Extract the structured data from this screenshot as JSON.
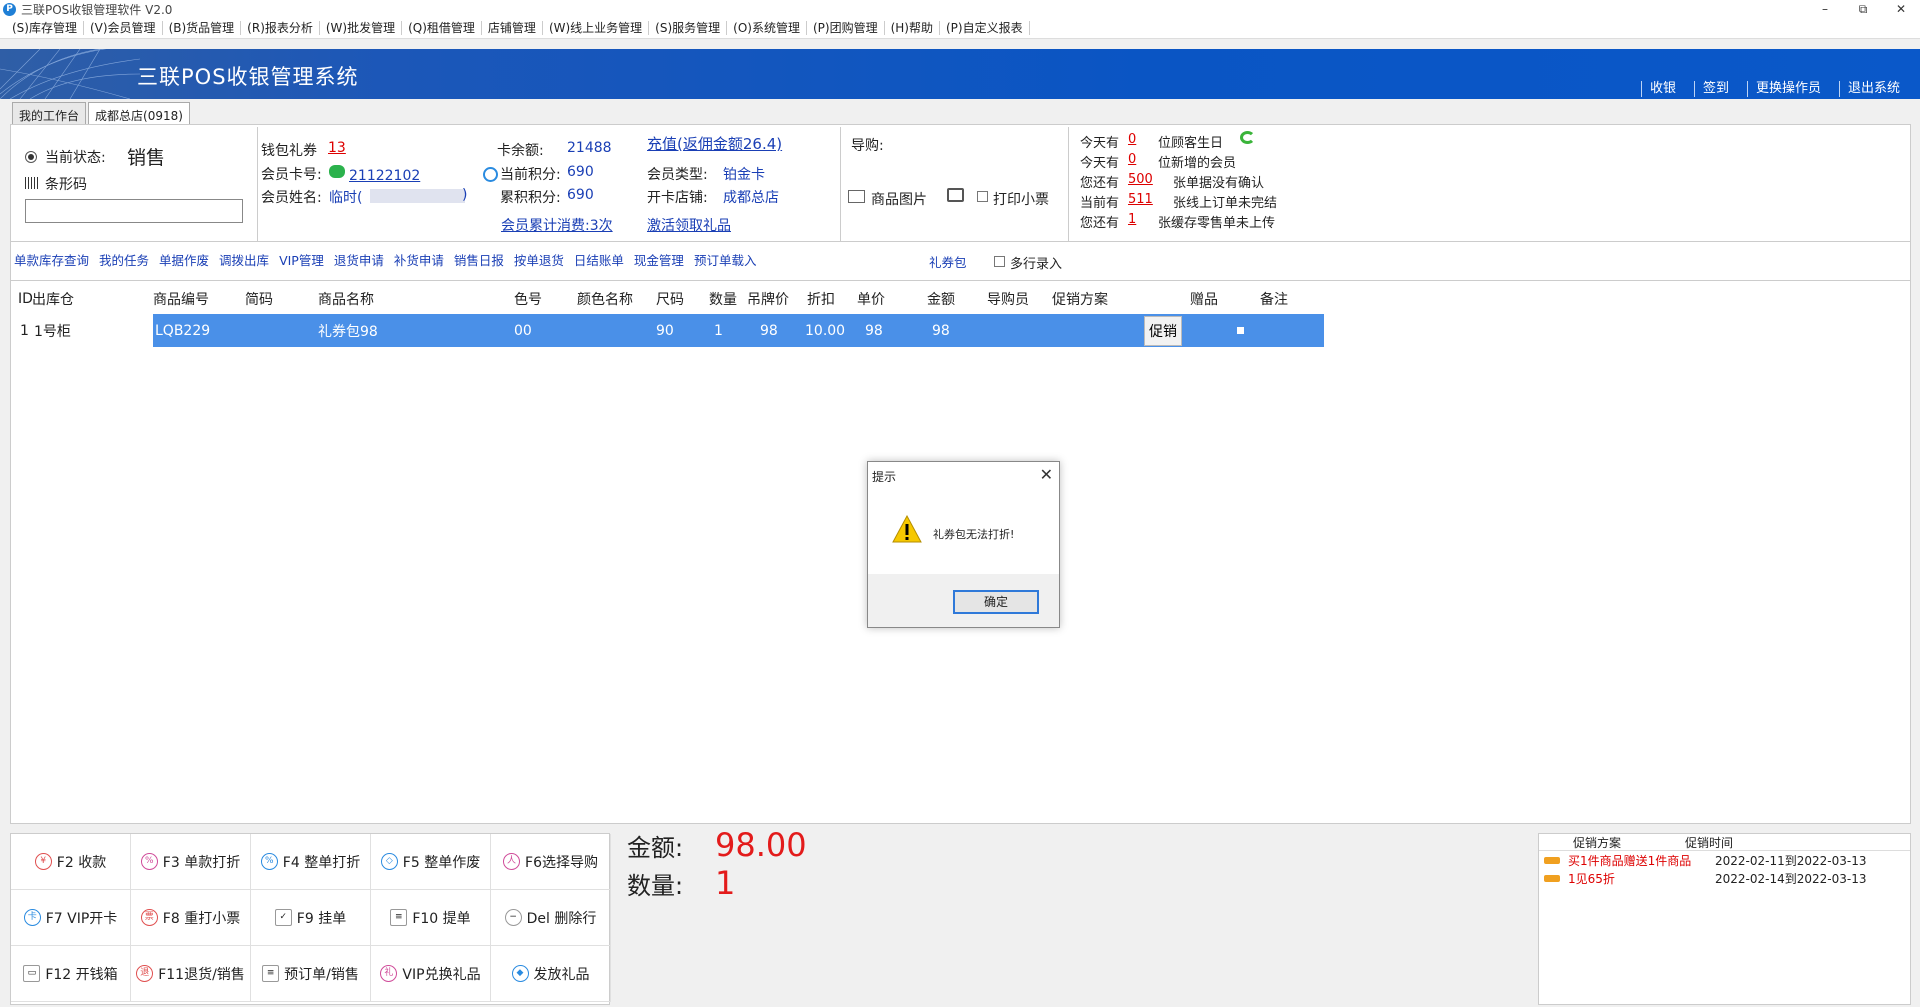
{
  "window": {
    "title": "三联POS收银管理软件 V2.0",
    "controls": [
      "–",
      "⧉",
      "✕"
    ]
  },
  "menu": [
    "(S)库存管理",
    "(V)会员管理",
    "(B)货品管理",
    "(R)报表分析",
    "(W)批发管理",
    "(Q)租借管理",
    "店铺管理",
    "(W)线上业务管理",
    "(S)服务管理",
    "(O)系统管理",
    "(P)团购管理",
    "(H)帮助",
    "(P)自定义报表"
  ],
  "banner": {
    "title": "三联POS收银管理系统",
    "nav": [
      "收银",
      "签到",
      "更换操作员",
      "退出系统"
    ]
  },
  "tabs": [
    "我的工作台",
    "成都总店(0918)"
  ],
  "status": {
    "state_label": "当前状态:",
    "state_value": "销售",
    "barcode_label": "条形码",
    "barcode_value": ""
  },
  "member": {
    "wallet_label": "钱包礼券",
    "wallet_value": "13",
    "card_label": "会员卡号:",
    "card_value": "21122102",
    "name_label": "会员姓名:",
    "name_value": "临时(",
    "name_suffix": ")",
    "balance_label": "卡余额:",
    "balance_value": "21488",
    "points_label": "当前积分:",
    "points_value": "690",
    "acc_points_label": "累积积分:",
    "acc_points_value": "690",
    "consume_link": "会员累计消费:3次",
    "recharge_link": "充值(返佣金额26.4)",
    "type_label": "会员类型:",
    "type_value": "铂金卡",
    "store_label": "开卡店铺:",
    "store_value": "成都总店",
    "activate_link": "激活领取礼品"
  },
  "guide": {
    "label": "导购:",
    "image_label": "商品图片",
    "print_label": "打印小票"
  },
  "notices": [
    {
      "pre": "今天有",
      "num": "0",
      "post": "位顾客生日"
    },
    {
      "pre": "今天有",
      "num": "0",
      "post": "位新增的会员"
    },
    {
      "pre": "您还有",
      "num": "500",
      "post": "张单据没有确认"
    },
    {
      "pre": "当前有",
      "num": "511",
      "post": "张线上订单未完结"
    },
    {
      "pre": "您还有",
      "num": "1",
      "post": "张缓存零售单未上传"
    }
  ],
  "actions": [
    "单款库存查询",
    "我的任务",
    "单据作废",
    "调拨出库",
    "VIP管理",
    "退货申请",
    "补货申请",
    "销售日报",
    "按单退货",
    "日结账单",
    "现金管理",
    "预订单载入"
  ],
  "gift_pack_link": "礼券包",
  "multi_line_label": "多行录入",
  "table": {
    "headers": [
      "ID",
      "出库仓",
      "商品编号",
      "简码",
      "商品名称",
      "色号",
      "颜色名称",
      "尺码",
      "数量",
      "吊牌价",
      "折扣",
      "单价",
      "金额",
      "导购员",
      "促销方案",
      "",
      "赠品",
      "备注"
    ],
    "rows": [
      {
        "id": "1",
        "warehouse": "1号柜",
        "code": "LQB229",
        "short": "",
        "name": "礼券包98",
        "color_no": "00",
        "color_name": "",
        "size": "90",
        "qty": "1",
        "tag_price": "98",
        "discount": "10.00",
        "unit_price": "98",
        "amount": "98",
        "guide": "",
        "promo": "",
        "promo_btn": "促销",
        "gift": "",
        "remark": ""
      }
    ]
  },
  "dialog": {
    "title": "提示",
    "message": "礼券包无法打折!",
    "ok": "确定"
  },
  "fkeys": [
    {
      "icon": "¥",
      "label": "F2 收款"
    },
    {
      "icon": "%",
      "label": "F3 单款打折"
    },
    {
      "icon": "%",
      "label": "F4 整单打折"
    },
    {
      "icon": "◇",
      "label": "F5 整单作废"
    },
    {
      "icon": "人",
      "label": "F6选择导购"
    },
    {
      "icon": "卡",
      "label": "F7 VIP开卡"
    },
    {
      "icon": "票",
      "label": "F8 重打小票"
    },
    {
      "icon": "✓",
      "label": "F9 挂单"
    },
    {
      "icon": "≡",
      "label": "F10 提单"
    },
    {
      "icon": "−",
      "label": "Del 删除行"
    },
    {
      "icon": "▭",
      "label": "F12 开钱箱"
    },
    {
      "icon": "退",
      "label": "F11退货/销售"
    },
    {
      "icon": "≡",
      "label": "预订单/销售"
    },
    {
      "icon": "礼",
      "label": "VIP兑换礼品"
    },
    {
      "icon": "◆",
      "label": "发放礼品"
    }
  ],
  "totals": {
    "amount_label": "金额:",
    "amount_value": "98.00",
    "qty_label": "数量:",
    "qty_value": "1"
  },
  "promotions": {
    "headers": [
      "促销方案",
      "促销时间"
    ],
    "rows": [
      {
        "name": "买1件商品赠送1件商品",
        "time": "2022-02-11到2022-03-13"
      },
      {
        "name": "1见65折",
        "time": "2022-02-14到2022-03-13"
      }
    ]
  },
  "colors": {
    "banner": "#0a55c4",
    "selected_row": "#4a90e8",
    "highlight_red": "#e31b1b",
    "link_blue": "#1a3fb5"
  }
}
